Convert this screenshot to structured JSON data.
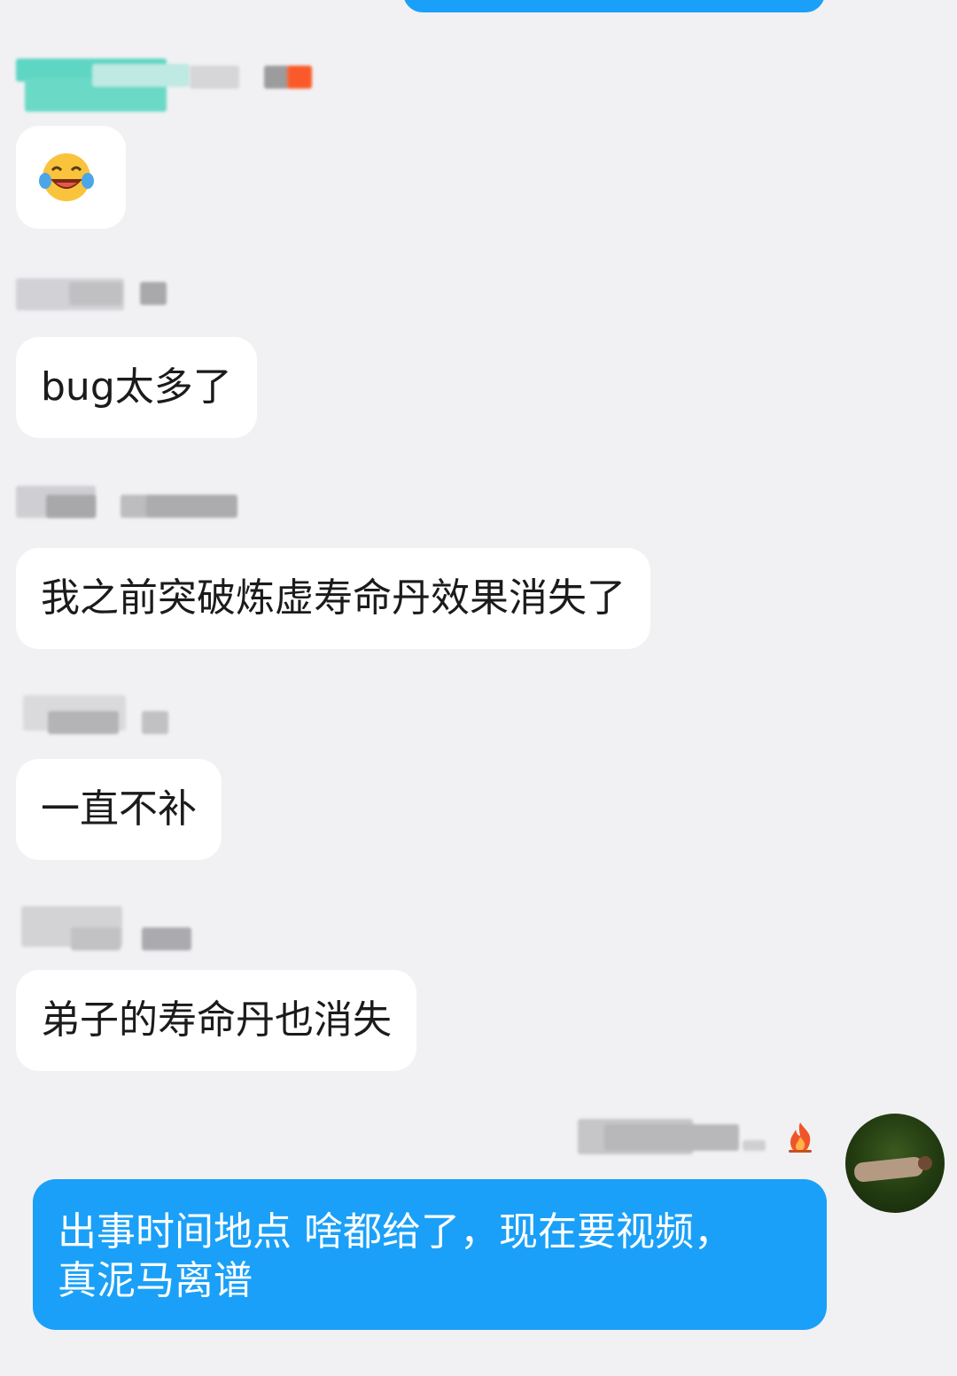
{
  "chat": {
    "messages": [
      {
        "sender_hidden": true,
        "type": "emoji",
        "emoji": "face-with-tears-of-joy"
      },
      {
        "sender_hidden": true,
        "type": "text",
        "text": "bug太多了"
      },
      {
        "sender_hidden": true,
        "type": "text",
        "text": "我之前突破炼虚寿命丹效果消失了"
      },
      {
        "sender_hidden": true,
        "type": "text",
        "text": "一直不补"
      },
      {
        "sender_hidden": true,
        "type": "text",
        "text": "弟子的寿命丹也消失"
      }
    ],
    "my_message": {
      "line1": "出事时间地点 啥都给了，现在要视频，",
      "line2": "真泥马离谱"
    }
  },
  "colors": {
    "background": "#f1f1f3",
    "incoming_bubble": "#ffffff",
    "outgoing_bubble": "#1aa0f8",
    "fire_icon": "#f0552a"
  }
}
